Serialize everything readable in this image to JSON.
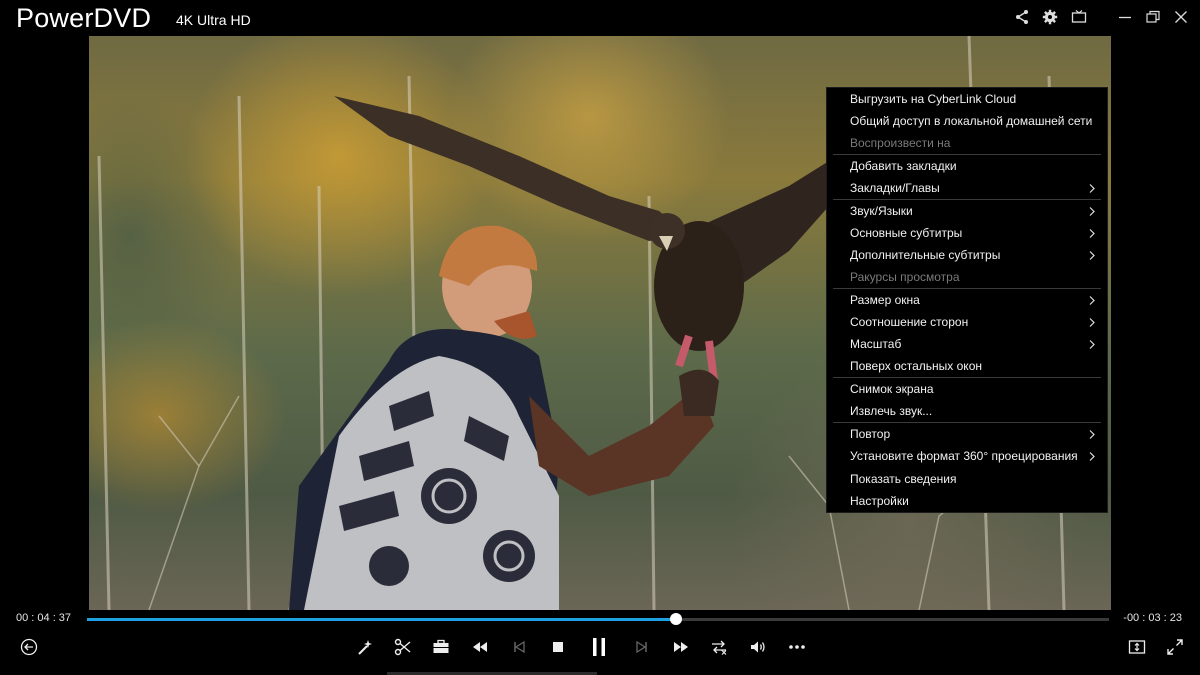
{
  "app": {
    "title": "PowerDVD",
    "quality": "4K Ultra HD"
  },
  "title_bar_icons": [
    "share-icon",
    "gear-icon",
    "tv-mode-icon",
    "minimize-icon",
    "restore-icon",
    "close-icon"
  ],
  "context_menu": {
    "items": [
      {
        "label": "Выгрузить на CyberLink Cloud",
        "disabled": false,
        "submenu": false
      },
      {
        "label": "Общий доступ в локальной домашней сети",
        "disabled": false,
        "submenu": false
      },
      {
        "label": "Воспроизвести на",
        "disabled": true,
        "submenu": false
      },
      {
        "label": "Добавить закладки",
        "disabled": false,
        "submenu": false
      },
      {
        "label": "Закладки/Главы",
        "disabled": false,
        "submenu": true
      },
      {
        "label": "Звук/Языки",
        "disabled": false,
        "submenu": true
      },
      {
        "label": "Основные субтитры",
        "disabled": false,
        "submenu": true
      },
      {
        "label": "Дополнительные субтитры",
        "disabled": false,
        "submenu": true
      },
      {
        "label": "Ракурсы просмотра",
        "disabled": true,
        "submenu": false
      },
      {
        "label": "Размер окна",
        "disabled": false,
        "submenu": true
      },
      {
        "label": "Соотношение сторон",
        "disabled": false,
        "submenu": true
      },
      {
        "label": "Масштаб",
        "disabled": false,
        "submenu": true
      },
      {
        "label": "Поверх остальных окон",
        "disabled": false,
        "submenu": false
      },
      {
        "label": "Снимок экрана",
        "disabled": false,
        "submenu": false
      },
      {
        "label": "Извлечь звук...",
        "disabled": false,
        "submenu": false
      },
      {
        "label": "Повтор",
        "disabled": false,
        "submenu": true
      },
      {
        "label": "Установите формат 360° проецирования",
        "disabled": false,
        "submenu": true
      },
      {
        "label": "Показать сведения",
        "disabled": false,
        "submenu": false
      },
      {
        "label": "Настройки",
        "disabled": false,
        "submenu": false
      }
    ]
  },
  "playback": {
    "elapsed": "00 : 04 : 37",
    "remaining": "-00 : 03 : 23",
    "progress_fraction": 0.576
  },
  "controls": {
    "icons": [
      "back-icon",
      "magic-wand-icon",
      "scissors-icon",
      "toolbox-icon",
      "rewind-icon",
      "previous-chapter-icon",
      "stop-icon",
      "pause-icon",
      "next-chapter-icon",
      "fast-forward-icon",
      "repeat-shuffle-icon",
      "volume-icon",
      "more-icon",
      "aspect-ratio-icon",
      "fullscreen-icon"
    ]
  },
  "colors": {
    "accent": "#1da1e0",
    "menu_bg": "#000000",
    "disabled_text": "#7a7a7a"
  }
}
